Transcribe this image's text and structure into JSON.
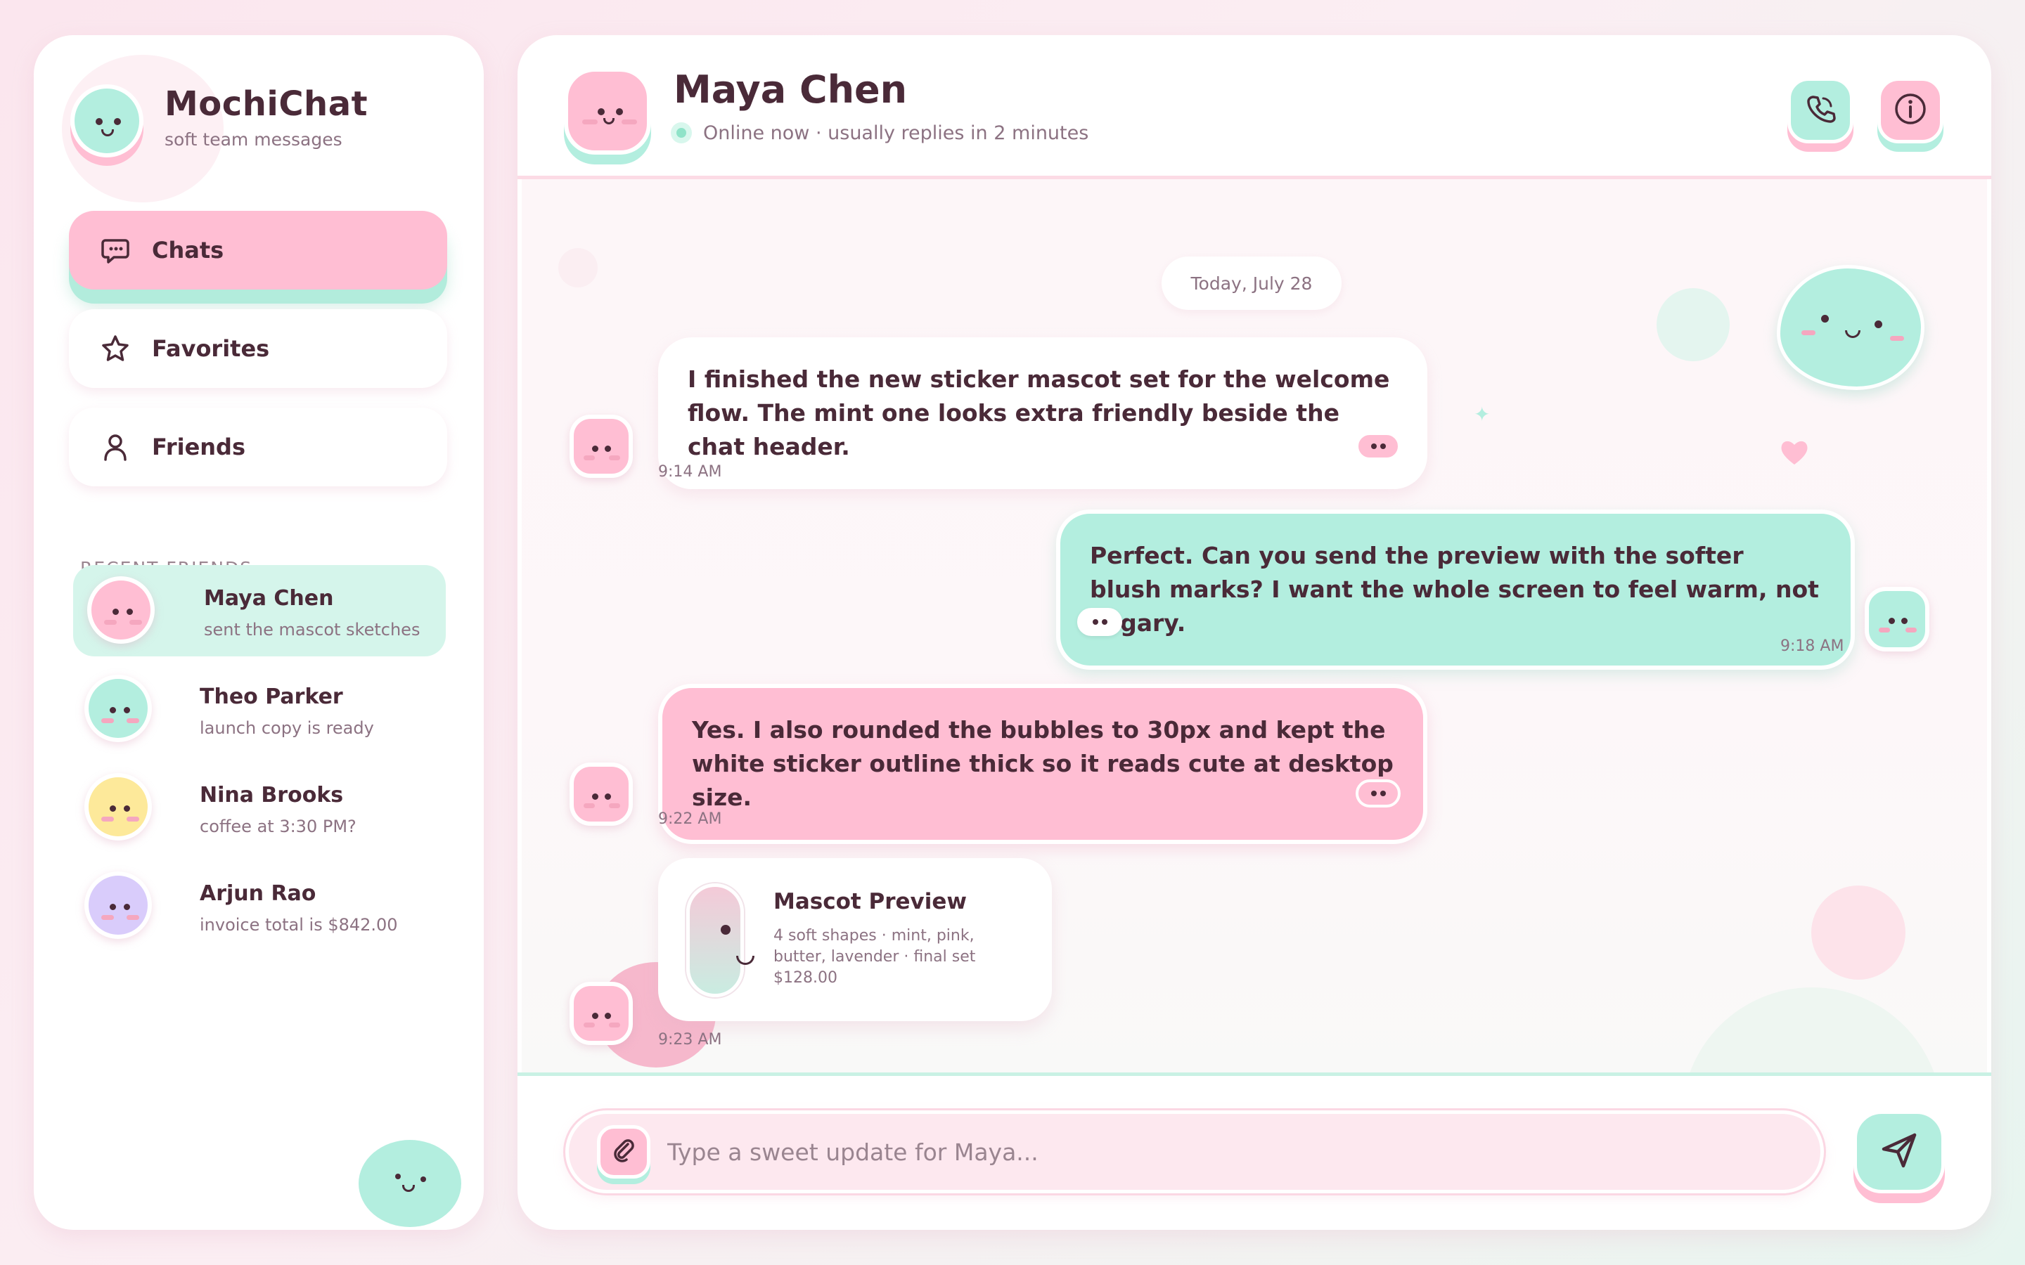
{
  "app": {
    "name": "MochiChat",
    "tagline": "soft team messages"
  },
  "nav": [
    {
      "label": "Chats",
      "icon": "chat-bubble-icon",
      "active": true
    },
    {
      "label": "Favorites",
      "icon": "star-icon",
      "active": false
    },
    {
      "label": "Friends",
      "icon": "person-icon",
      "active": false
    }
  ],
  "recent_friends": {
    "heading": "RECENT FRIENDS",
    "items": [
      {
        "name": "Maya Chen",
        "message": "sent the mascot sketches",
        "color": "#ffbed3",
        "active": true
      },
      {
        "name": "Theo Parker",
        "message": "launch copy is ready",
        "color": "#b3eedf",
        "active": false
      },
      {
        "name": "Nina Brooks",
        "message": "coffee at 3:30 PM?",
        "color": "#fde99a",
        "active": false
      },
      {
        "name": "Arjun Rao",
        "message": "invoice total is $842.00",
        "color": "#d9ccfb",
        "active": false
      }
    ]
  },
  "chat": {
    "contact_name": "Maya Chen",
    "status": "Online now · usually replies in 2 minutes",
    "date_divider": "Today, July 28",
    "messages": [
      {
        "text": "I finished the new sticker mascot set for the welcome flow. The mint one looks extra friendly beside the chat header.",
        "time": "9:14 AM",
        "from": "contact",
        "style": "white"
      },
      {
        "text": "Perfect. Can you send the preview with the softer blush marks? I want the whole screen to feel warm, not sugary.",
        "time": "9:18 AM",
        "from": "me",
        "style": "mint"
      },
      {
        "text": "Yes. I also rounded the bubbles to 30px and kept the white sticker outline thick so it reads cute at desktop size.",
        "time": "9:22 AM",
        "from": "contact",
        "style": "pink"
      }
    ],
    "attachment": {
      "title": "Mascot Preview",
      "description": "4 soft shapes · mint, pink, butter, lavender · final set $128.00",
      "time": "9:23 AM"
    },
    "composer_placeholder": "Type a sweet update for Maya..."
  },
  "colors": {
    "pink": "#ffbed3",
    "mint": "#b3eedf",
    "text": "#4a2a38",
    "muted": "#8c7282"
  }
}
